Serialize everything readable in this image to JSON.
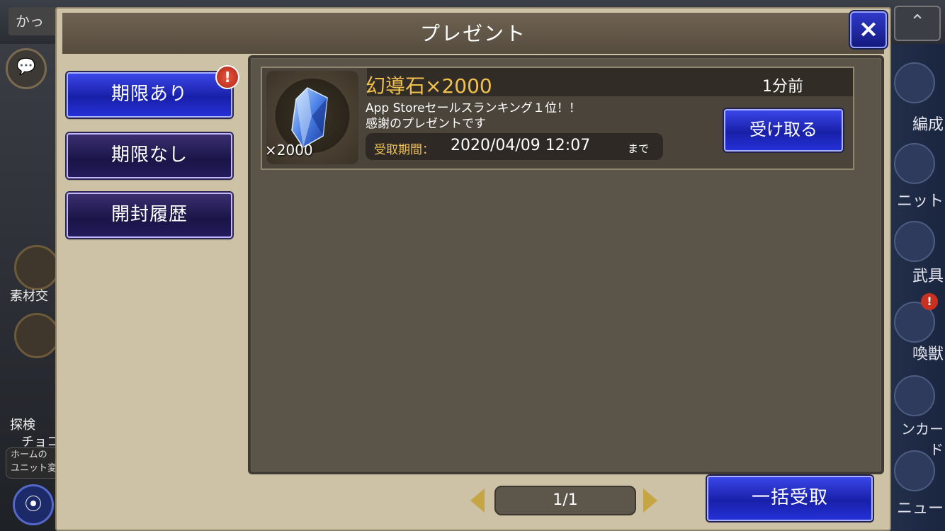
{
  "modal": {
    "title": "プレゼント",
    "close_icon": "×"
  },
  "sidebar": {
    "items": [
      {
        "label": "期限あり",
        "active": true,
        "alert": "!"
      },
      {
        "label": "期限なし",
        "active": false
      },
      {
        "label": "開封履歴",
        "active": false
      }
    ]
  },
  "presents": [
    {
      "name": "幻導石×2000",
      "quantity": "×2000",
      "time_ago": "1分前",
      "description_line1": "App Storeセールスランキング１位！！",
      "description_line2": "感謝のプレゼントです",
      "deadline_label": "受取期間：",
      "deadline_date": "2020/04/09 12:07",
      "deadline_suffix": "まで",
      "receive_label": "受け取る",
      "icon": "crystal-icon"
    }
  ],
  "pager": {
    "text": "1/1"
  },
  "bulk_receive_label": "一括受取",
  "background": {
    "username": "かっ",
    "left_labels": [
      "素材交",
      "探検",
      "チョコ"
    ],
    "tooltip_line1": "ホームの",
    "tooltip_line2": "ユニット変",
    "right_menu": [
      "編成",
      "ニット",
      "武具",
      "喚獣",
      "ンカード",
      "ニュー"
    ]
  },
  "colors": {
    "accent_gold": "#f2c04d",
    "button_blue": "#2530d6",
    "alert_red": "#c8311f"
  }
}
